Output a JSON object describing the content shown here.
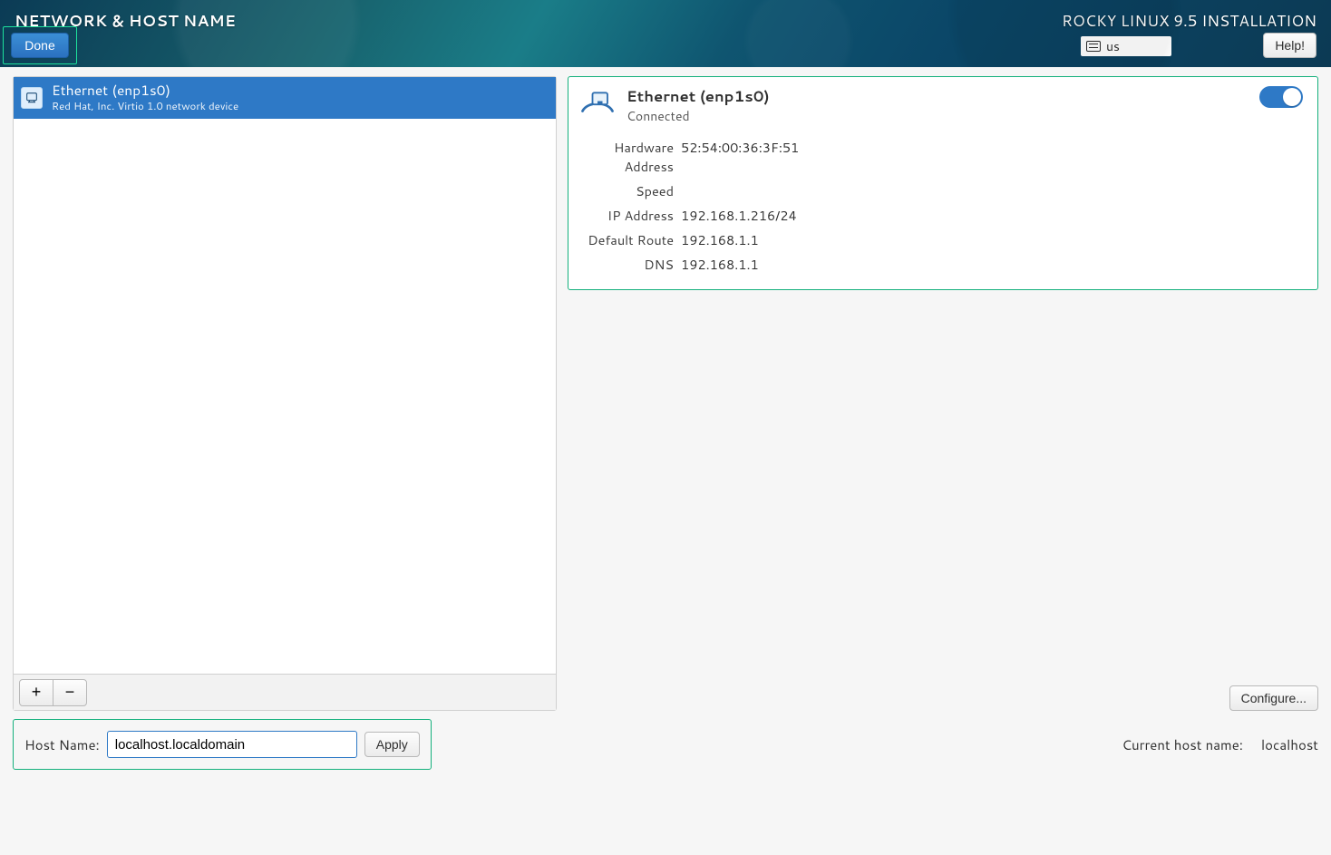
{
  "header": {
    "title_left": "NETWORK & HOST NAME",
    "title_right": "ROCKY LINUX 9.5 INSTALLATION",
    "done_label": "Done",
    "help_label": "Help!",
    "kb_layout": "us"
  },
  "devices": [
    {
      "name": "Ethernet (enp1s0)",
      "desc": "Red Hat, Inc. Virtio 1.0 network device",
      "selected": true
    }
  ],
  "toolbar": {
    "add": "+",
    "remove": "−"
  },
  "details": {
    "name": "Ethernet (enp1s0)",
    "status": "Connected",
    "fields": {
      "hardware_address_label": "Hardware Address",
      "hardware_address": "52:54:00:36:3F:51",
      "speed_label": "Speed",
      "speed": "",
      "ip_label": "IP Address",
      "ip": "192.168.1.216/24",
      "route_label": "Default Route",
      "route": "192.168.1.1",
      "dns_label": "DNS",
      "dns": "192.168.1.1"
    },
    "switch_on": true,
    "configure_label": "Configure..."
  },
  "hostname": {
    "label": "Host Name:",
    "value": "localhost.localdomain",
    "apply_label": "Apply",
    "current_label": "Current host name:",
    "current_value": "localhost"
  }
}
